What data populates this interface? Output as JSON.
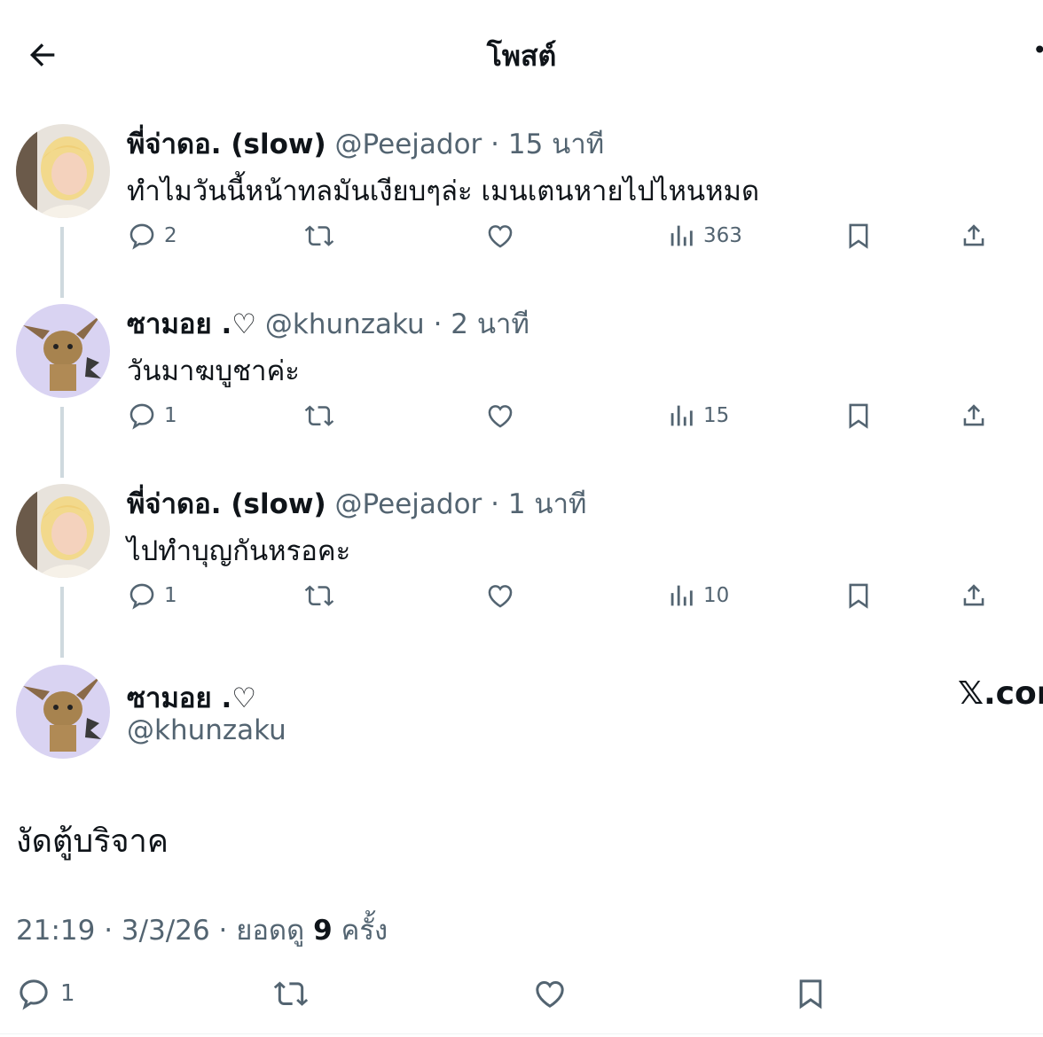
{
  "header": {
    "title": "โพสต์"
  },
  "replies": [
    {
      "name": "พี่จ่าดอ. (slow)",
      "handle": "@Peejador",
      "time": "15 นาที",
      "text": "ทำไมวันนี้หน้าทลมันเงียบๆล่ะ เมนเตนหายไปไหนหมด",
      "reply_count": "2",
      "view_count": "363",
      "avatar": "blonde-person-avatar"
    },
    {
      "name": "ซามอย .♡",
      "handle": "@khunzaku",
      "time": "2 นาที",
      "text": "วันมาฆบูชาค่ะ",
      "reply_count": "1",
      "view_count": "15",
      "avatar": "cat-pikachu-avatar"
    },
    {
      "name": "พี่จ่าดอ. (slow)",
      "handle": "@Peejador",
      "time": "1 นาที",
      "text": "ไปทำบุญกันหรอคะ",
      "reply_count": "1",
      "view_count": "10",
      "avatar": "blonde-person-avatar"
    }
  ],
  "main": {
    "name": "ซามอย .♡",
    "handle": "@khunzaku",
    "watermark": "𝕏.com",
    "text": "งัดตู้บริจาค",
    "timestamp": "21:19 · 3/3/26 · ยอดดู",
    "views": "9",
    "views_suffix": "ครั้ง",
    "reply_count": "1"
  },
  "colors": {
    "text": "#0f1419",
    "secondary": "#536471",
    "thread_line": "#cfd9de",
    "avatar_bg": "#d9d3f2"
  }
}
